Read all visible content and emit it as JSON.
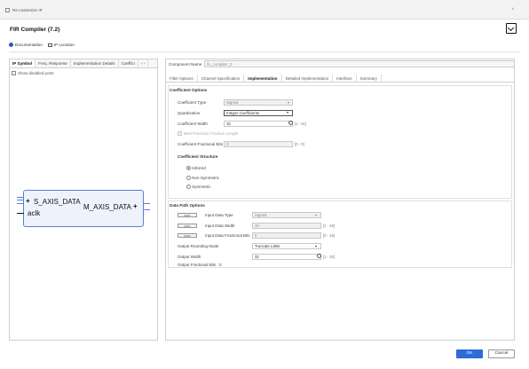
{
  "window": {
    "title": "Re-customize IP",
    "close_glyph": "×"
  },
  "component_title": "FIR Compiler (7.2)",
  "links": {
    "documentation": "Documentation",
    "ip_location": "IP Location"
  },
  "left_panel": {
    "tabs": [
      "IP Symbol",
      "Freq. Response",
      "Implementation Details",
      "Coeffici"
    ],
    "tab_controls": "‹ ›",
    "show_disabled_ports": "Show disabled ports",
    "symbol": {
      "in_port": "S_AXIS_DATA",
      "clk": "aclk",
      "out_port": "M_AXIS_DATA"
    }
  },
  "right_panel": {
    "component_name_label": "Component Name",
    "component_name_value": "fir_compiler_0",
    "tabs": [
      "Filter Options",
      "Channel Specification",
      "Implementation",
      "Detailed Implementation",
      "Interface",
      "Summary"
    ],
    "active_tab": "Implementation",
    "coefficient_options": {
      "title": "Coefficient Options",
      "coefficient_type_label": "Coefficient Type",
      "coefficient_type_value": "Signed",
      "quantization_label": "Quantization",
      "quantization_value": "Integer Coefficients",
      "coefficient_width_label": "Coefficient Width",
      "coefficient_width_value": "16",
      "coefficient_width_range": "[1 - 51]",
      "best_precision_label": "Best Precision Fraction Length",
      "fractional_bits_label": "Coefficient Fractional Bits",
      "fractional_bits_value": "0",
      "fractional_bits_range": "[0 - 0]"
    },
    "coefficient_structure": {
      "title": "Coefficient Structure",
      "options": [
        "Inferred",
        "Non Symmetric",
        "Symmetric"
      ],
      "selected": "Inferred"
    },
    "data_path_options": {
      "title": "Data Path Options",
      "input_type_label": "Input Data Type",
      "input_type_value": "Signed",
      "input_width_label": "Input Data Width",
      "input_width_value": "16",
      "input_width_range": "[1 - 49]",
      "input_frac_label": "Input Data Fractional Bits",
      "input_frac_value": "0",
      "input_frac_range": "[0 - 16]",
      "rounding_label": "Output Rounding Mode",
      "rounding_value": "Truncate LSBs",
      "output_width_label": "Output Width",
      "output_width_value": "32",
      "output_width_range": "[1 - 32]",
      "output_frac_label": "Output Fractional Bits : 0",
      "toggle_text": "auto"
    }
  },
  "buttons": {
    "ok": "OK",
    "cancel": "Cancel"
  },
  "colors": {
    "accent": "#2d6bd6",
    "symbol_border": "#5b7fd6"
  }
}
